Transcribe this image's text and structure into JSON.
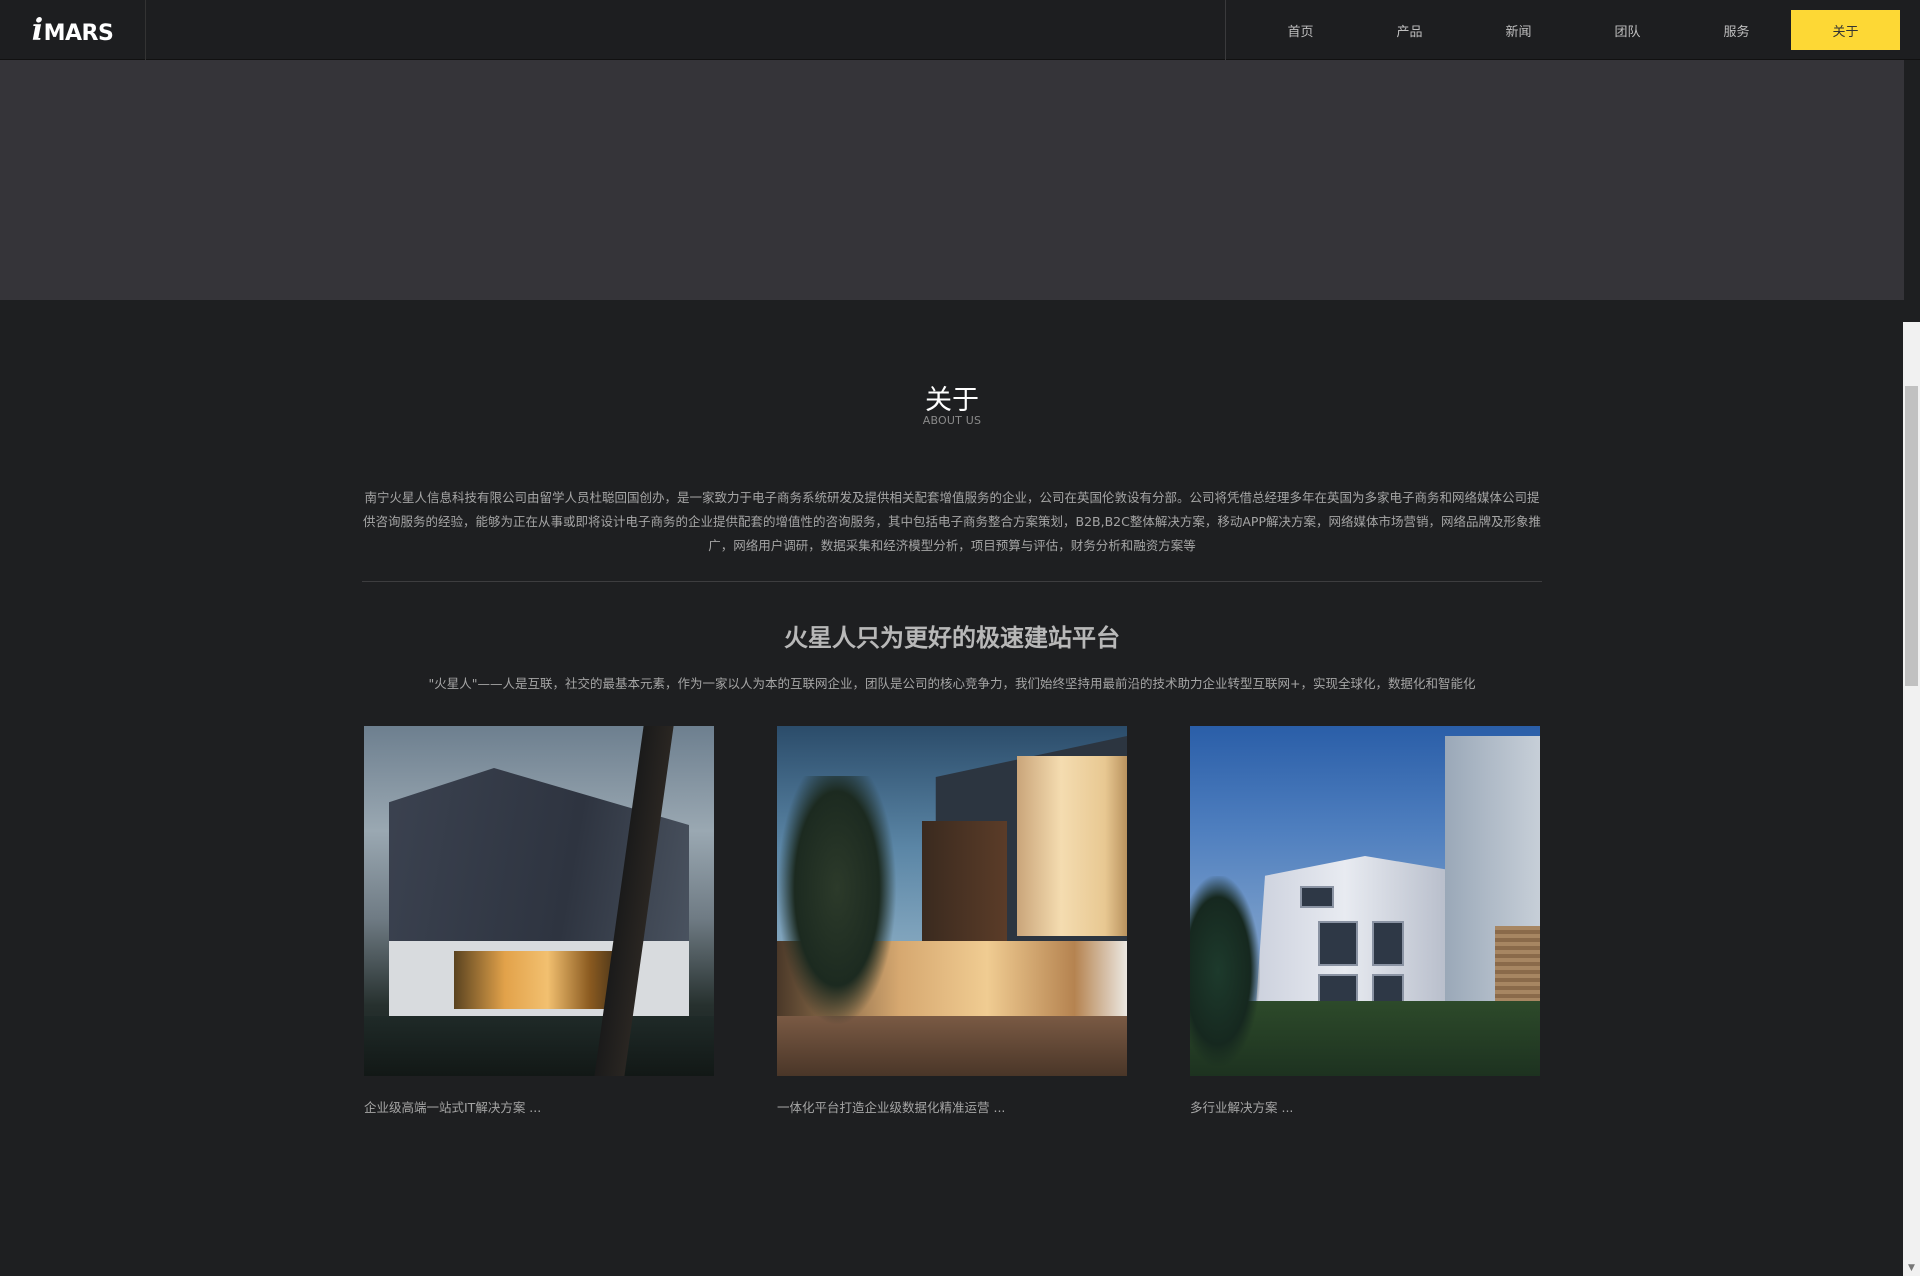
{
  "header": {
    "logo_text": "MARS",
    "logo_prefix": "i",
    "nav": [
      {
        "label": "首页",
        "active": false
      },
      {
        "label": "产品",
        "active": false
      },
      {
        "label": "新闻",
        "active": false
      },
      {
        "label": "团队",
        "active": false
      },
      {
        "label": "服务",
        "active": false
      },
      {
        "label": "关于",
        "active": true
      }
    ]
  },
  "about": {
    "title": "关于",
    "subtitle": "ABOUT US",
    "description": "南宁火星人信息科技有限公司由留学人员杜聪回国创办，是一家致力于电子商务系统研发及提供相关配套增值服务的企业，公司在英国伦敦设有分部。公司将凭借总经理多年在英国为多家电子商务和网络媒体公司提供咨询服务的经验，能够为正在从事或即将设计电子商务的企业提供配套的增值性的咨询服务，其中包括电子商务整合方案策划，B2B,B2C整体解决方案，移动APP解决方案，网络媒体市场营销，网络品牌及形象推广，网络用户调研，数据采集和经济模型分析，项目预算与评估，财务分析和融资方案等",
    "slogan": "火星人只为更好的极速建站平台",
    "slogan_desc": "\"火星人\"——人是互联，社交的最基本元素，作为一家以人为本的互联网企业，团队是公司的核心竞争力，我们始终坚持用最前沿的技术助力企业转型互联网+，实现全球化，数据化和智能化"
  },
  "cards": [
    {
      "caption": "企业级高端一站式IT解决方案 ..."
    },
    {
      "caption": "一体化平台打造企业级数据化精准运营 ..."
    },
    {
      "caption": "多行业解决方案 ..."
    }
  ],
  "colors": {
    "accent": "#fdd835",
    "header_bg": "#1d1e20",
    "banner_bg": "#353439",
    "page_bg": "#1e1f21"
  }
}
